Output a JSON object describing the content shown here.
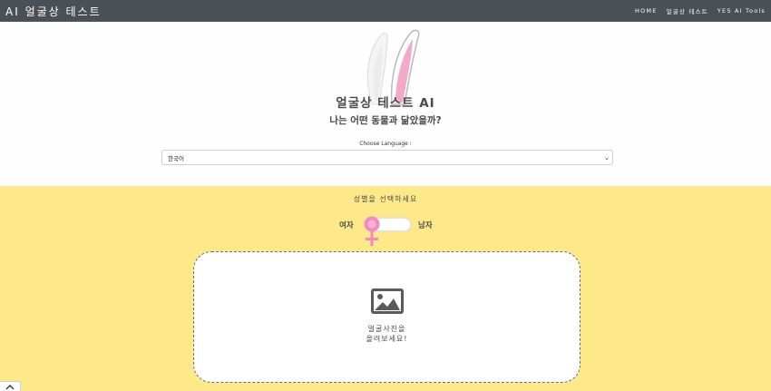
{
  "navbar": {
    "brand": "AI 얼굴상 테스트",
    "links": [
      "HOME",
      "얼굴상 테스트",
      "YES AI Tools"
    ]
  },
  "header": {
    "title": "얼굴상 테스트 AI",
    "subtitle": "나는 어떤 동물과 닮았을까?",
    "language_label": "Choose Language :",
    "language_selected": "한국어"
  },
  "gender": {
    "title": "성별을 선택하세요",
    "female_label": "여자",
    "male_label": "남자",
    "selected": "female"
  },
  "upload": {
    "line1": "얼굴사진을",
    "line2": "올려보세요!"
  },
  "colors": {
    "navbar": "#4b4f56",
    "yellow": "#fde98a",
    "pink": "#f08bc0",
    "ear_pink": "#f3a9c8"
  },
  "icons": {
    "upload": "image-icon",
    "scroll": "chevron-up-icon",
    "select": "chevron-down-icon",
    "gender": "female-symbol-icon"
  }
}
